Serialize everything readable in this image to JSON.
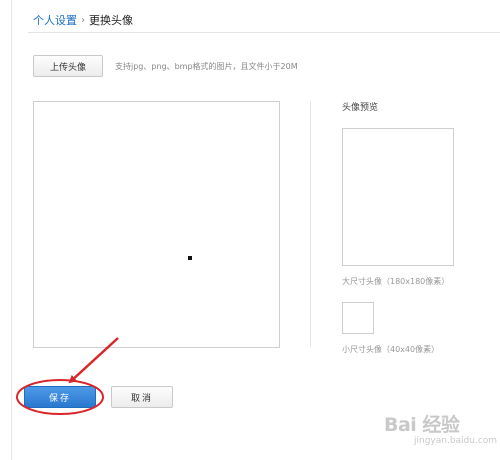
{
  "breadcrumb": {
    "parent": "个人设置",
    "separator": "›",
    "current": "更换头像"
  },
  "upload": {
    "button_label": "上传头像",
    "hint": "支持jpg、png、bmp格式的图片，且文件小于20M"
  },
  "preview": {
    "title": "头像预览",
    "large_label": "大尺寸头像（180x180像素）",
    "small_label": "小尺寸头像（40x40像素）"
  },
  "actions": {
    "save_label": "保存",
    "cancel_label": "取消"
  },
  "colors": {
    "link": "#1a6fc7",
    "primary_button": "#2a78cf",
    "annotation": "#d9262b"
  },
  "watermark": {
    "logo": "Bai 经验",
    "sub": "jingyan.baidu.com"
  }
}
